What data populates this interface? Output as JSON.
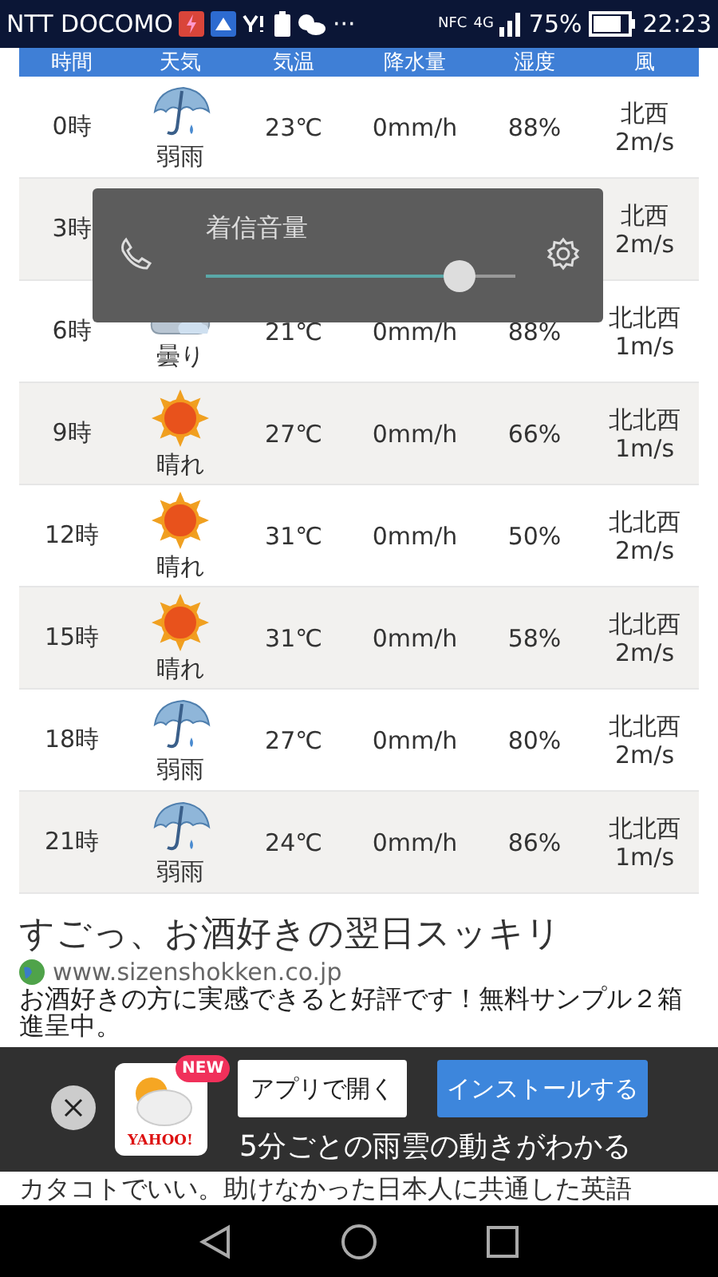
{
  "status_bar": {
    "carrier": "NTT DOCOMO",
    "more": "···",
    "nfc": "NFC",
    "network": "4G",
    "battery": "75%",
    "time": "22:23"
  },
  "table": {
    "columns": [
      "時間",
      "天気",
      "気温",
      "降水量",
      "湿度",
      "風"
    ],
    "rows": [
      {
        "time": "0時",
        "weather": {
          "kind": "rain",
          "label": "弱雨"
        },
        "temp": "23℃",
        "rain": "0mm/h",
        "humidity": "88%",
        "wind_dir": "北西",
        "wind_speed": "2m/s"
      },
      {
        "time": "3時",
        "wind_dir": "北西",
        "wind_speed": "2m/s"
      },
      {
        "time": "6時",
        "weather": {
          "kind": "cloud",
          "label": "曇り"
        },
        "temp": "21℃",
        "rain": "0mm/h",
        "humidity": "88%",
        "wind_dir": "北北西",
        "wind_speed": "1m/s"
      },
      {
        "time": "9時",
        "weather": {
          "kind": "sun",
          "label": "晴れ"
        },
        "temp": "27℃",
        "rain": "0mm/h",
        "humidity": "66%",
        "wind_dir": "北北西",
        "wind_speed": "1m/s"
      },
      {
        "time": "12時",
        "weather": {
          "kind": "sun",
          "label": "晴れ"
        },
        "temp": "31℃",
        "rain": "0mm/h",
        "humidity": "50%",
        "wind_dir": "北北西",
        "wind_speed": "2m/s"
      },
      {
        "time": "15時",
        "weather": {
          "kind": "sun",
          "label": "晴れ"
        },
        "temp": "31℃",
        "rain": "0mm/h",
        "humidity": "58%",
        "wind_dir": "北北西",
        "wind_speed": "2m/s"
      },
      {
        "time": "18時",
        "weather": {
          "kind": "rain",
          "label": "弱雨"
        },
        "temp": "27℃",
        "rain": "0mm/h",
        "humidity": "80%",
        "wind_dir": "北北西",
        "wind_speed": "2m/s"
      },
      {
        "time": "21時",
        "weather": {
          "kind": "rain",
          "label": "弱雨"
        },
        "temp": "24℃",
        "rain": "0mm/h",
        "humidity": "86%",
        "wind_dir": "北北西",
        "wind_speed": "1m/s"
      }
    ]
  },
  "ads": [
    {
      "title": "すごっ、お酒好きの翌日スッキリ",
      "domain": "www.sizenshokken.co.jp",
      "description": "お酒好きの方に実感できると好評です！無料サンプル２箱進呈中。"
    },
    {
      "description": "カタコトでいい。助けなかった日本人に共通した英語"
    }
  ],
  "volume_dialog": {
    "title": "着信音量",
    "level": 0.82
  },
  "app_banner": {
    "badge": "NEW",
    "logo": "YAHOO!",
    "open_button": "アプリで開く",
    "install_button": "インストールする",
    "caption": "5分ごとの雨雲の動きがわかる"
  }
}
